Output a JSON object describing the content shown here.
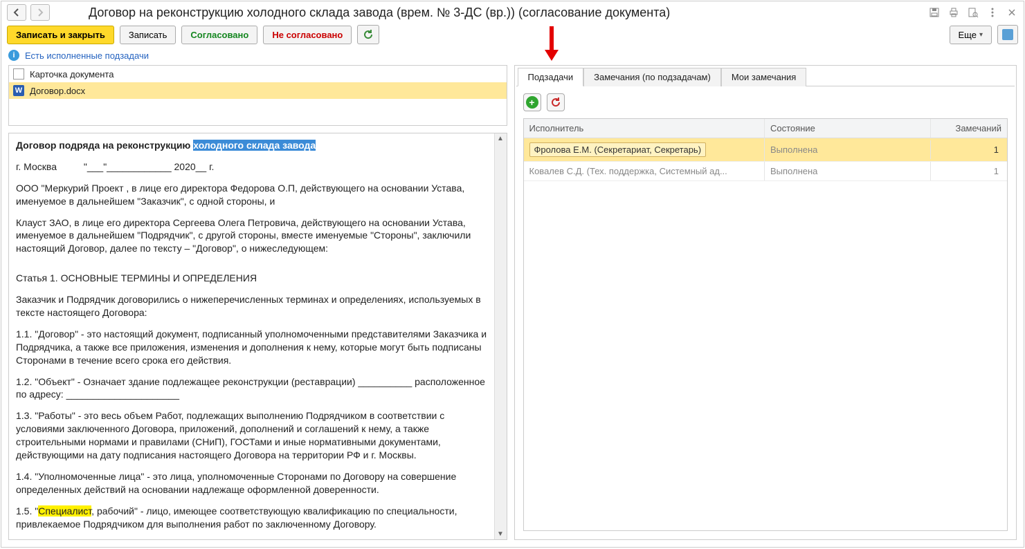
{
  "title": "Договор на реконструкцию холодного склада завода (врем. № 3-ДС (вр.)) (согласование документа)",
  "toolbar": {
    "save_close": "Записать и закрыть",
    "save": "Записать",
    "agree": "Согласовано",
    "disagree": "Не согласовано",
    "more": "Еще"
  },
  "info": {
    "text": "Есть исполненные подзадачи"
  },
  "files": {
    "row0": "Карточка документа",
    "row1": "Договор.docx"
  },
  "doc": {
    "title_prefix": "Договор подряда на реконструкцию ",
    "title_highlight": "холодного склада завода",
    "city_line": "г. Москва          \"___\"____________ 2020__ г.",
    "p1": "ООО \"Меркурий Проект , в лице его директора Федорова О.П, действующего на основании Устава, именуемое в дальнейшем \"Заказчик\", с одной стороны, и",
    "p2": "Клауст ЗАО, в лице его директора Сергеева Олега Петровича, действующего на основании Устава, именуемое в дальнейшем \"Подрядчик\", с другой стороны, вместе именуемые \"Стороны\", заключили настоящий Договор,  далее по тексту – \"Договор\",  о нижеследующем:",
    "art1": "Статья 1. ОСНОВНЫЕ ТЕРМИНЫ И ОПРЕДЕЛЕНИЯ",
    "p3": "Заказчик и Подрядчик договорились о нижеперечисленных терминах и определениях, используемых в тексте настоящего Договора:",
    "p4": "1.1. \"Договор\" - это настоящий документ, подписанный уполномоченными представителями Заказчика и Подрядчика, а также все приложения, изменения и дополнения к нему, которые могут быть подписаны Сторонами в течение всего срока его действия.",
    "p5": "1.2. \"Объект\" - Означает здание подлежащее реконструкции (реставрации) __________ расположенное по адресу: _____________________",
    "p6": "1.3. \"Работы\" - это весь объем Работ, подлежащих выполнению Подрядчиком в соответствии с условиями заключенного Договора, приложений, дополнений и соглашений к нему, а также строительными нормами и правилами (СНиП), ГОСТами и иные нормативными документами, действующими на дату подписания настоящего Договора на территории РФ и г. Москвы.",
    "p7": "1.4. \"Уполномоченные лица\" - это лица, уполномоченные Сторонами по Договору на совершение определенных действий на основании надлежаще оформленной доверенности.",
    "p8a": "1.5. \"",
    "p8h": "Специалист",
    "p8b": ", рабочий\" - лицо, имеющее соответствующую квалификацию по специальности, привлекаемое Подрядчиком для выполнения работ по заключенному Договору."
  },
  "tabs": {
    "t0": "Подзадачи",
    "t1": "Замечания (по подзадачам)",
    "t2": "Мои замечания"
  },
  "grid": {
    "h0": "Исполнитель",
    "h1": "Состояние",
    "h2": "Замечаний",
    "r0": {
      "exec": "Фролова Е.М. (Секретариат, Секретарь)",
      "state": "Выполнена",
      "count": "1"
    },
    "r1": {
      "exec": "Ковалев С.Д. (Тех. поддержка, Системный ад...",
      "state": "Выполнена",
      "count": "1"
    }
  }
}
